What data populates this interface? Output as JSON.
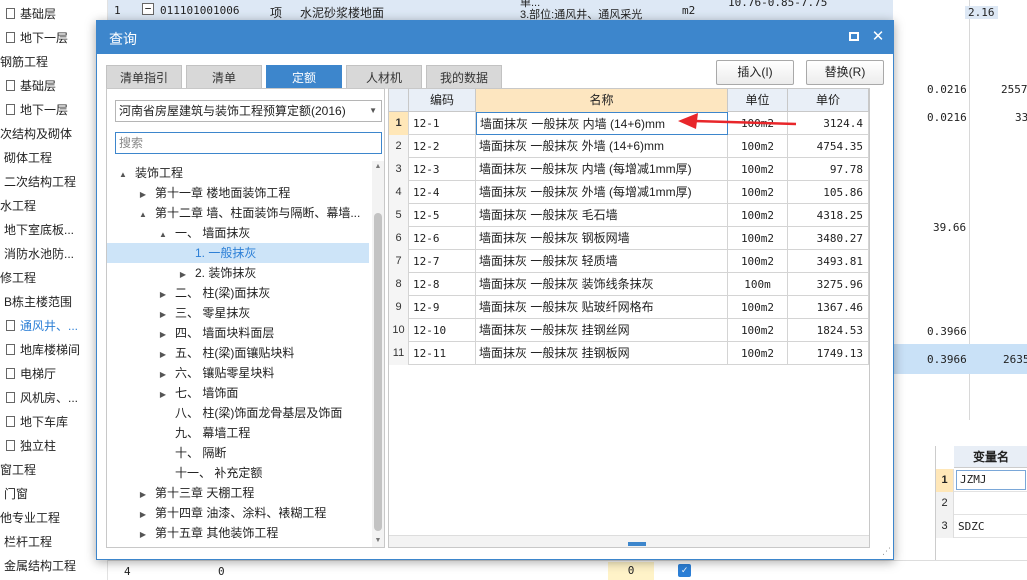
{
  "background": {
    "sidebar_items": [
      {
        "label": "基础层",
        "doc": true,
        "sel": false
      },
      {
        "label": "地下一层",
        "doc": true,
        "sel": false
      },
      {
        "label": "钢筋工程",
        "doc": false,
        "sel": false
      },
      {
        "label": "基础层",
        "doc": true,
        "sel": false
      },
      {
        "label": "地下一层",
        "doc": true,
        "sel": false
      },
      {
        "label": "次结构及砌体",
        "doc": false,
        "sel": false
      },
      {
        "label": "砌体工程",
        "doc": false,
        "sel": false
      },
      {
        "label": "二次结构工程",
        "doc": false,
        "sel": false
      },
      {
        "label": "水工程",
        "doc": false,
        "sel": false
      },
      {
        "label": "地下室底板...",
        "doc": false,
        "sel": false
      },
      {
        "label": "消防水池防...",
        "doc": false,
        "sel": false
      },
      {
        "label": "修工程",
        "doc": false,
        "sel": false
      },
      {
        "label": "B栋主楼范围",
        "doc": false,
        "sel": false
      },
      {
        "label": "通风井、...",
        "doc": true,
        "sel": true
      },
      {
        "label": "地库楼梯间",
        "doc": true,
        "sel": false
      },
      {
        "label": "电梯厅",
        "doc": true,
        "sel": false
      },
      {
        "label": "风机房、...",
        "doc": true,
        "sel": false
      },
      {
        "label": "地下车库",
        "doc": true,
        "sel": false
      },
      {
        "label": "独立柱",
        "doc": true,
        "sel": false
      },
      {
        "label": "窗工程",
        "doc": false,
        "sel": false
      },
      {
        "label": "门窗",
        "doc": false,
        "sel": false
      },
      {
        "label": "他专业工程",
        "doc": false,
        "sel": false
      },
      {
        "label": "栏杆工程",
        "doc": false,
        "sel": false
      },
      {
        "label": "金属结构工程",
        "doc": false,
        "sel": false
      }
    ],
    "top_row": {
      "row_num": "1",
      "expander": "−",
      "code": "011101001006",
      "type": "项",
      "name": "水泥砂浆楼地面",
      "desc_line1": "单...",
      "desc_line2": "3.部位:通风井、通风采光",
      "unit": "m2",
      "formula": "10.76-0.85-7.75",
      "qty": "2.16"
    },
    "right_values": {
      "a1": "0.0216",
      "b1": "2557",
      "a2": "0.0216",
      "b2": "33",
      "mid": "39.66",
      "a3": "0.3966",
      "a4": "0.3966",
      "b4": "2635"
    },
    "bottom_row": {
      "row_num": "4",
      "val1": "0",
      "val2": "0"
    },
    "var_panel": {
      "header": "变量名",
      "rows": [
        {
          "n": "1",
          "v": "JZMJ"
        },
        {
          "n": "2",
          "v": ""
        },
        {
          "n": "3",
          "v": "SDZC"
        }
      ]
    }
  },
  "dialog": {
    "title": "查询",
    "tabs": [
      "清单指引",
      "清单",
      "定额",
      "人材机",
      "我的数据"
    ],
    "active_tab": "定额",
    "insert_label": "插入(I)",
    "replace_label": "替换(R)",
    "quota_library": "河南省房屋建筑与装饰工程预算定额(2016)",
    "search_placeholder": "搜索",
    "tree": [
      {
        "label": "装饰工程",
        "exp": "▲",
        "indent": 0,
        "sel": false
      },
      {
        "label": "第十一章 楼地面装饰工程",
        "exp": "▶",
        "indent": 1,
        "sel": false
      },
      {
        "label": "第十二章 墙、柱面装饰与隔断、幕墙...",
        "exp": "▲",
        "indent": 1,
        "sel": false
      },
      {
        "label": "一、 墙面抹灰",
        "exp": "▲",
        "indent": 2,
        "sel": false
      },
      {
        "label": "1. 一般抹灰",
        "exp": "",
        "indent": 3,
        "sel": true
      },
      {
        "label": "2. 装饰抹灰",
        "exp": "▶",
        "indent": 3,
        "sel": false
      },
      {
        "label": "二、 柱(梁)面抹灰",
        "exp": "▶",
        "indent": 2,
        "sel": false
      },
      {
        "label": "三、 零星抹灰",
        "exp": "▶",
        "indent": 2,
        "sel": false
      },
      {
        "label": "四、 墙面块料面层",
        "exp": "▶",
        "indent": 2,
        "sel": false
      },
      {
        "label": "五、 柱(梁)面镶贴块料",
        "exp": "▶",
        "indent": 2,
        "sel": false
      },
      {
        "label": "六、 镶贴零星块料",
        "exp": "▶",
        "indent": 2,
        "sel": false
      },
      {
        "label": "七、 墙饰面",
        "exp": "▶",
        "indent": 2,
        "sel": false
      },
      {
        "label": "八、 柱(梁)饰面龙骨基层及饰面",
        "exp": "",
        "indent": 2,
        "sel": false
      },
      {
        "label": "九、 幕墙工程",
        "exp": "",
        "indent": 2,
        "sel": false
      },
      {
        "label": "十、 隔断",
        "exp": "",
        "indent": 2,
        "sel": false
      },
      {
        "label": "十一、 补充定额",
        "exp": "",
        "indent": 2,
        "sel": false
      },
      {
        "label": "第十三章 天棚工程",
        "exp": "▶",
        "indent": 1,
        "sel": false
      },
      {
        "label": "第十四章 油漆、涂料、裱糊工程",
        "exp": "▶",
        "indent": 1,
        "sel": false
      },
      {
        "label": "第十五章 其他装饰工程",
        "exp": "▶",
        "indent": 1,
        "sel": false
      }
    ],
    "table": {
      "headers": [
        "",
        "编码",
        "名称",
        "单位",
        "单价"
      ],
      "rows": [
        {
          "n": "1",
          "code": "12-1",
          "name": "墙面抹灰 一般抹灰 内墙 (14+6)mm",
          "unit": "100m2",
          "price": "3124.4"
        },
        {
          "n": "2",
          "code": "12-2",
          "name": "墙面抹灰 一般抹灰 外墙 (14+6)mm",
          "unit": "100m2",
          "price": "4754.35"
        },
        {
          "n": "3",
          "code": "12-3",
          "name": "墙面抹灰 一般抹灰 内墙 (每增减1mm厚)",
          "unit": "100m2",
          "price": "97.78"
        },
        {
          "n": "4",
          "code": "12-4",
          "name": "墙面抹灰 一般抹灰 外墙 (每增减1mm厚)",
          "unit": "100m2",
          "price": "105.86"
        },
        {
          "n": "5",
          "code": "12-5",
          "name": "墙面抹灰 一般抹灰 毛石墙",
          "unit": "100m2",
          "price": "4318.25"
        },
        {
          "n": "6",
          "code": "12-6",
          "name": "墙面抹灰 一般抹灰 钢板网墙",
          "unit": "100m2",
          "price": "3480.27"
        },
        {
          "n": "7",
          "code": "12-7",
          "name": "墙面抹灰 一般抹灰 轻质墙",
          "unit": "100m2",
          "price": "3493.81"
        },
        {
          "n": "8",
          "code": "12-8",
          "name": "墙面抹灰 一般抹灰 装饰线条抹灰",
          "unit": "100m",
          "price": "3275.96"
        },
        {
          "n": "9",
          "code": "12-9",
          "name": "墙面抹灰 一般抹灰 贴玻纤网格布",
          "unit": "100m2",
          "price": "1367.46"
        },
        {
          "n": "10",
          "code": "12-10",
          "name": "墙面抹灰 一般抹灰 挂钢丝网",
          "unit": "100m2",
          "price": "1824.53"
        },
        {
          "n": "11",
          "code": "12-11",
          "name": "墙面抹灰 一般抹灰 挂钢板网",
          "unit": "100m2",
          "price": "1749.13"
        }
      ]
    },
    "colors": {
      "accent": "#3d86cc",
      "arrow": "#e8262a",
      "name_header": "#fde6c0"
    }
  }
}
